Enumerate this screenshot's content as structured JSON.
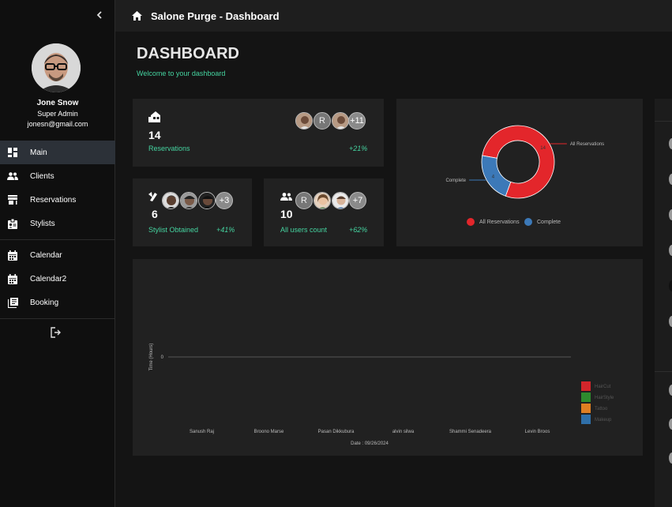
{
  "sidebar": {
    "user": {
      "name": "Jone Snow",
      "role": "Super Admin",
      "email": "jonesn@gmail.com"
    },
    "items": [
      {
        "label": "Main",
        "icon": "dashboard-icon",
        "active": true
      },
      {
        "label": "Clients",
        "icon": "people-icon"
      },
      {
        "label": "Reservations",
        "icon": "store-icon"
      },
      {
        "label": "Stylists",
        "icon": "badge-icon"
      },
      {
        "label": "Calendar",
        "icon": "calendar-icon"
      },
      {
        "label": "Calendar2",
        "icon": "calendar-icon"
      },
      {
        "label": "Booking",
        "icon": "library-icon"
      }
    ]
  },
  "header": {
    "title": "Salone Purge - Dashboard"
  },
  "page": {
    "title": "DASHBOARD",
    "subtitle": "Welcome to your dashboard"
  },
  "stats": {
    "reservations": {
      "value": "14",
      "label": "Reservations",
      "change": "+21%",
      "avatar_letter": "R",
      "more": "+11"
    },
    "stylists": {
      "value": "6",
      "label": "Stylist Obtained",
      "change": "+41%",
      "more": "+3"
    },
    "users": {
      "value": "10",
      "label": "All users count",
      "change": "+62%",
      "avatar_letter": "R",
      "more": "+7"
    }
  },
  "chart_data": [
    {
      "type": "pie",
      "subtype": "donut",
      "slices": [
        {
          "label": "All Reservations",
          "value": 14,
          "color": "#e3262b"
        },
        {
          "label": "Complete",
          "value": 4,
          "color": "#3c79b8"
        }
      ],
      "legend": "bottom"
    },
    {
      "type": "bar",
      "categories": [
        "Sanush Raj",
        "Broono Marse",
        "Pasan Dikkubura",
        "alvin silwa",
        "Shammi Senadeera",
        "Levin Broos"
      ],
      "series": [
        {
          "name": "HairCut",
          "values": [
            0,
            0,
            0,
            0,
            0,
            0
          ],
          "color": "#d3262b"
        },
        {
          "name": "HairStyle",
          "values": [
            0,
            0,
            0,
            0,
            0,
            0
          ],
          "color": "#2e8b2e"
        },
        {
          "name": "Tattoo",
          "values": [
            0,
            0,
            0,
            0,
            0,
            0
          ],
          "color": "#e07f22"
        },
        {
          "name": "Makeup",
          "values": [
            0,
            0,
            0,
            0,
            0,
            0
          ],
          "color": "#2f6fa8"
        }
      ],
      "xlabel": "Date : 09/26/2024",
      "ylabel": "Time (Hours)",
      "yticks": [
        "0"
      ],
      "legend": "right"
    }
  ]
}
